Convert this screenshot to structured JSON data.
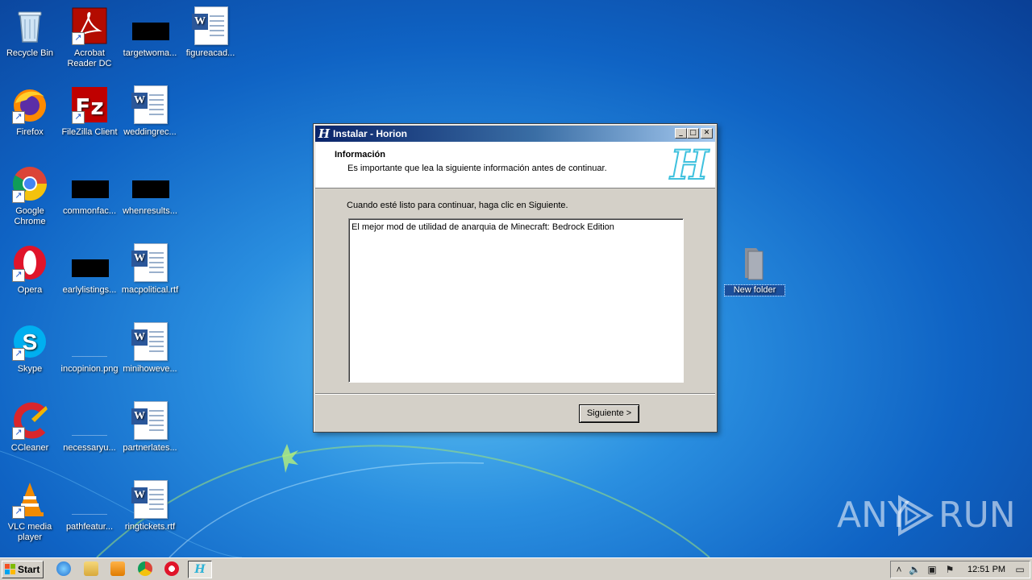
{
  "desktop": {
    "icons": [
      {
        "label": "Recycle Bin"
      },
      {
        "label": "Acrobat Reader DC"
      },
      {
        "label": "targetwoma..."
      },
      {
        "label": "figureacad..."
      },
      {
        "label": "Firefox"
      },
      {
        "label": "FileZilla Client"
      },
      {
        "label": "weddingrec..."
      },
      {
        "label": "Google Chrome"
      },
      {
        "label": "commonfac..."
      },
      {
        "label": "whenresults..."
      },
      {
        "label": "Opera"
      },
      {
        "label": "earlylistings..."
      },
      {
        "label": "macpolitical.rtf"
      },
      {
        "label": "Skype"
      },
      {
        "label": "incopinion.png"
      },
      {
        "label": "minihoweve..."
      },
      {
        "label": "CCleaner"
      },
      {
        "label": "necessaryu..."
      },
      {
        "label": "partnerlates..."
      },
      {
        "label": "VLC media player"
      },
      {
        "label": "pathfeatur..."
      },
      {
        "label": "ringtickets.rtf"
      },
      {
        "label": "New folder"
      }
    ]
  },
  "installer": {
    "title": "Instalar - Horion",
    "header_title": "Información",
    "header_subtitle": "Es importante que lea la siguiente información antes de continuar.",
    "prompt": "Cuando esté listo para continuar, haga clic en Siguiente.",
    "info_text": "El mejor mod de utilidad de anarquia de Minecraft: Bedrock Edition",
    "next_button": "Siguiente >",
    "logo_glyph": "H"
  },
  "taskbar": {
    "start_label": "Start",
    "clock": "12:51 PM",
    "active_item_glyph": "H"
  },
  "watermark": {
    "left": "ANY",
    "right": "RUN"
  },
  "colors": {
    "titlebar_start": "#0a246a",
    "titlebar_end": "#a6caf0",
    "horion_accent": "#3fc1de",
    "dialog_face": "#d4d0c8"
  }
}
